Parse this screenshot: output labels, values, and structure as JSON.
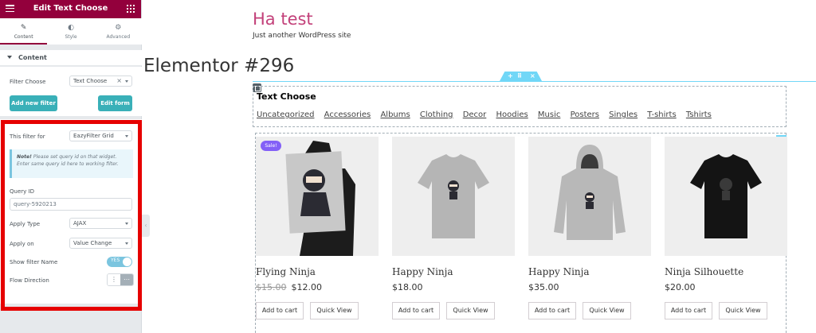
{
  "panel": {
    "title": "Edit Text Choose",
    "tabs": [
      {
        "label": "Content",
        "icon": "pencil-icon"
      },
      {
        "label": "Style",
        "icon": "contrast-icon"
      },
      {
        "label": "Advanced",
        "icon": "gear-icon"
      }
    ],
    "section_label": "Content",
    "filter_choose": {
      "label": "Filter Choose",
      "value": "Text Choose"
    },
    "add_new_filter": "Add new filter",
    "edit_form": "Edit form",
    "filter_for": {
      "label": "This filter for",
      "value": "EazyFilter Grid"
    },
    "note": {
      "strong": "Note!",
      "text": " Please set query id on that widget. Enter same query id here to working filter."
    },
    "query_id": {
      "label": "Query ID",
      "value": "query-5920213"
    },
    "apply_type": {
      "label": "Apply Type",
      "value": "AJAX"
    },
    "apply_on": {
      "label": "Apply on",
      "value": "Value Change"
    },
    "show_filter_name": {
      "label": "Show filter Name",
      "toggle_text": "YES",
      "on": true
    },
    "flow_direction": {
      "label": "Flow Direction",
      "options": [
        "vertical",
        "horizontal"
      ],
      "selected": "horizontal"
    },
    "accent_color": "#93003c",
    "button_color": "#39b0b8",
    "highlight_color": "#e60000"
  },
  "site": {
    "title": "Ha test",
    "tagline": "Just another WordPress site"
  },
  "page_title": "Elementor #296",
  "filter_widget": {
    "title": "Text Choose",
    "links": [
      "Uncategorized",
      "Accessories",
      "Albums",
      "Clothing",
      "Decor",
      "Hoodies",
      "Music",
      "Posters",
      "Singles",
      "T-shirts",
      "Tshirts"
    ]
  },
  "products": [
    {
      "name": "Flying Ninja",
      "old_price": "$15.00",
      "price": "$12.00",
      "sale": "Sale!",
      "image": "poster-icon",
      "cart": "Add to cart",
      "quick": "Quick View"
    },
    {
      "name": "Happy Ninja",
      "old_price": "",
      "price": "$18.00",
      "sale": "",
      "image": "tshirt-icon",
      "cart": "Add to cart",
      "quick": "Quick View"
    },
    {
      "name": "Happy Ninja",
      "old_price": "",
      "price": "$35.00",
      "sale": "",
      "image": "hoodie-icon",
      "cart": "Add to cart",
      "quick": "Quick View"
    },
    {
      "name": "Ninja Silhouette",
      "old_price": "",
      "price": "$20.00",
      "sale": "",
      "image": "tshirt-icon",
      "cart": "Add to cart",
      "quick": "Quick View"
    }
  ]
}
